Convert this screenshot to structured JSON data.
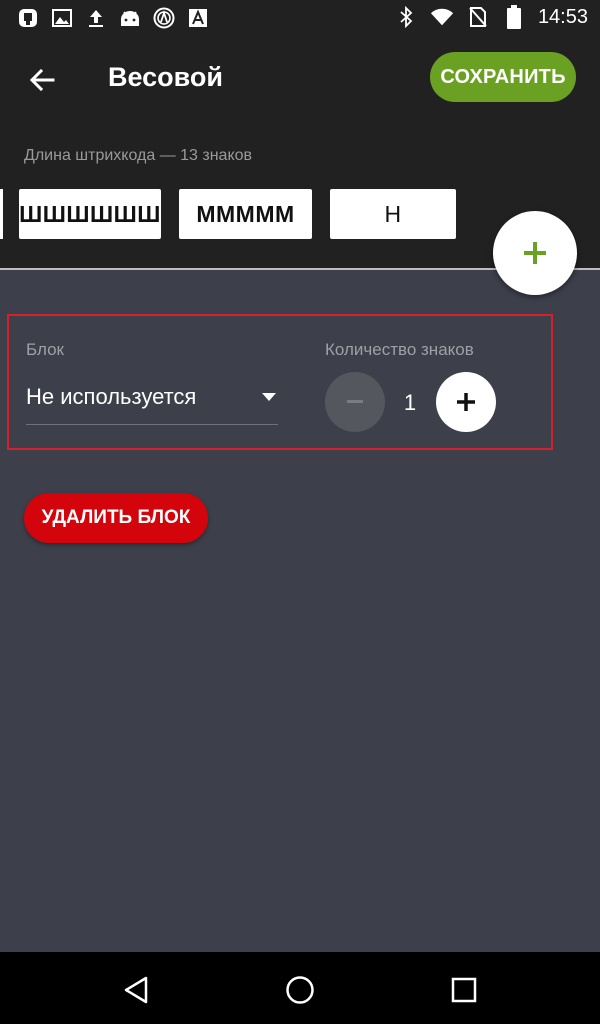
{
  "status_bar": {
    "left_icons": [
      "download-notification-icon",
      "image-notification-icon",
      "upload-icon",
      "android-icon",
      "vpn-icon",
      "font-app-icon"
    ],
    "right_icons": [
      "bluetooth-icon",
      "wifi-icon",
      "no-sim-icon",
      "battery-icon"
    ],
    "time": "14:53"
  },
  "app_bar": {
    "title": "Весовой",
    "save_label": "СОХРАНИТЬ"
  },
  "block_bar": {
    "length_label": "Длина штрихкода — 13 знаков",
    "chips": [
      {
        "label": "ШШШШШШ",
        "selected": false
      },
      {
        "label": "ММММM",
        "selected": false
      },
      {
        "label": "Н",
        "selected": true
      }
    ],
    "add_icon": "plus-icon"
  },
  "block_settings": {
    "block_label": "Блок",
    "block_value": "Не используется",
    "count_label": "Количество знаков",
    "count_value": "1"
  },
  "delete_label": "УДАЛИТЬ БЛОК",
  "colors": {
    "accent_green": "#6aa122",
    "delete_red": "#d4040c",
    "highlight_border": "#d3212d",
    "background": "#3d3f4b",
    "bar": "#212121"
  }
}
